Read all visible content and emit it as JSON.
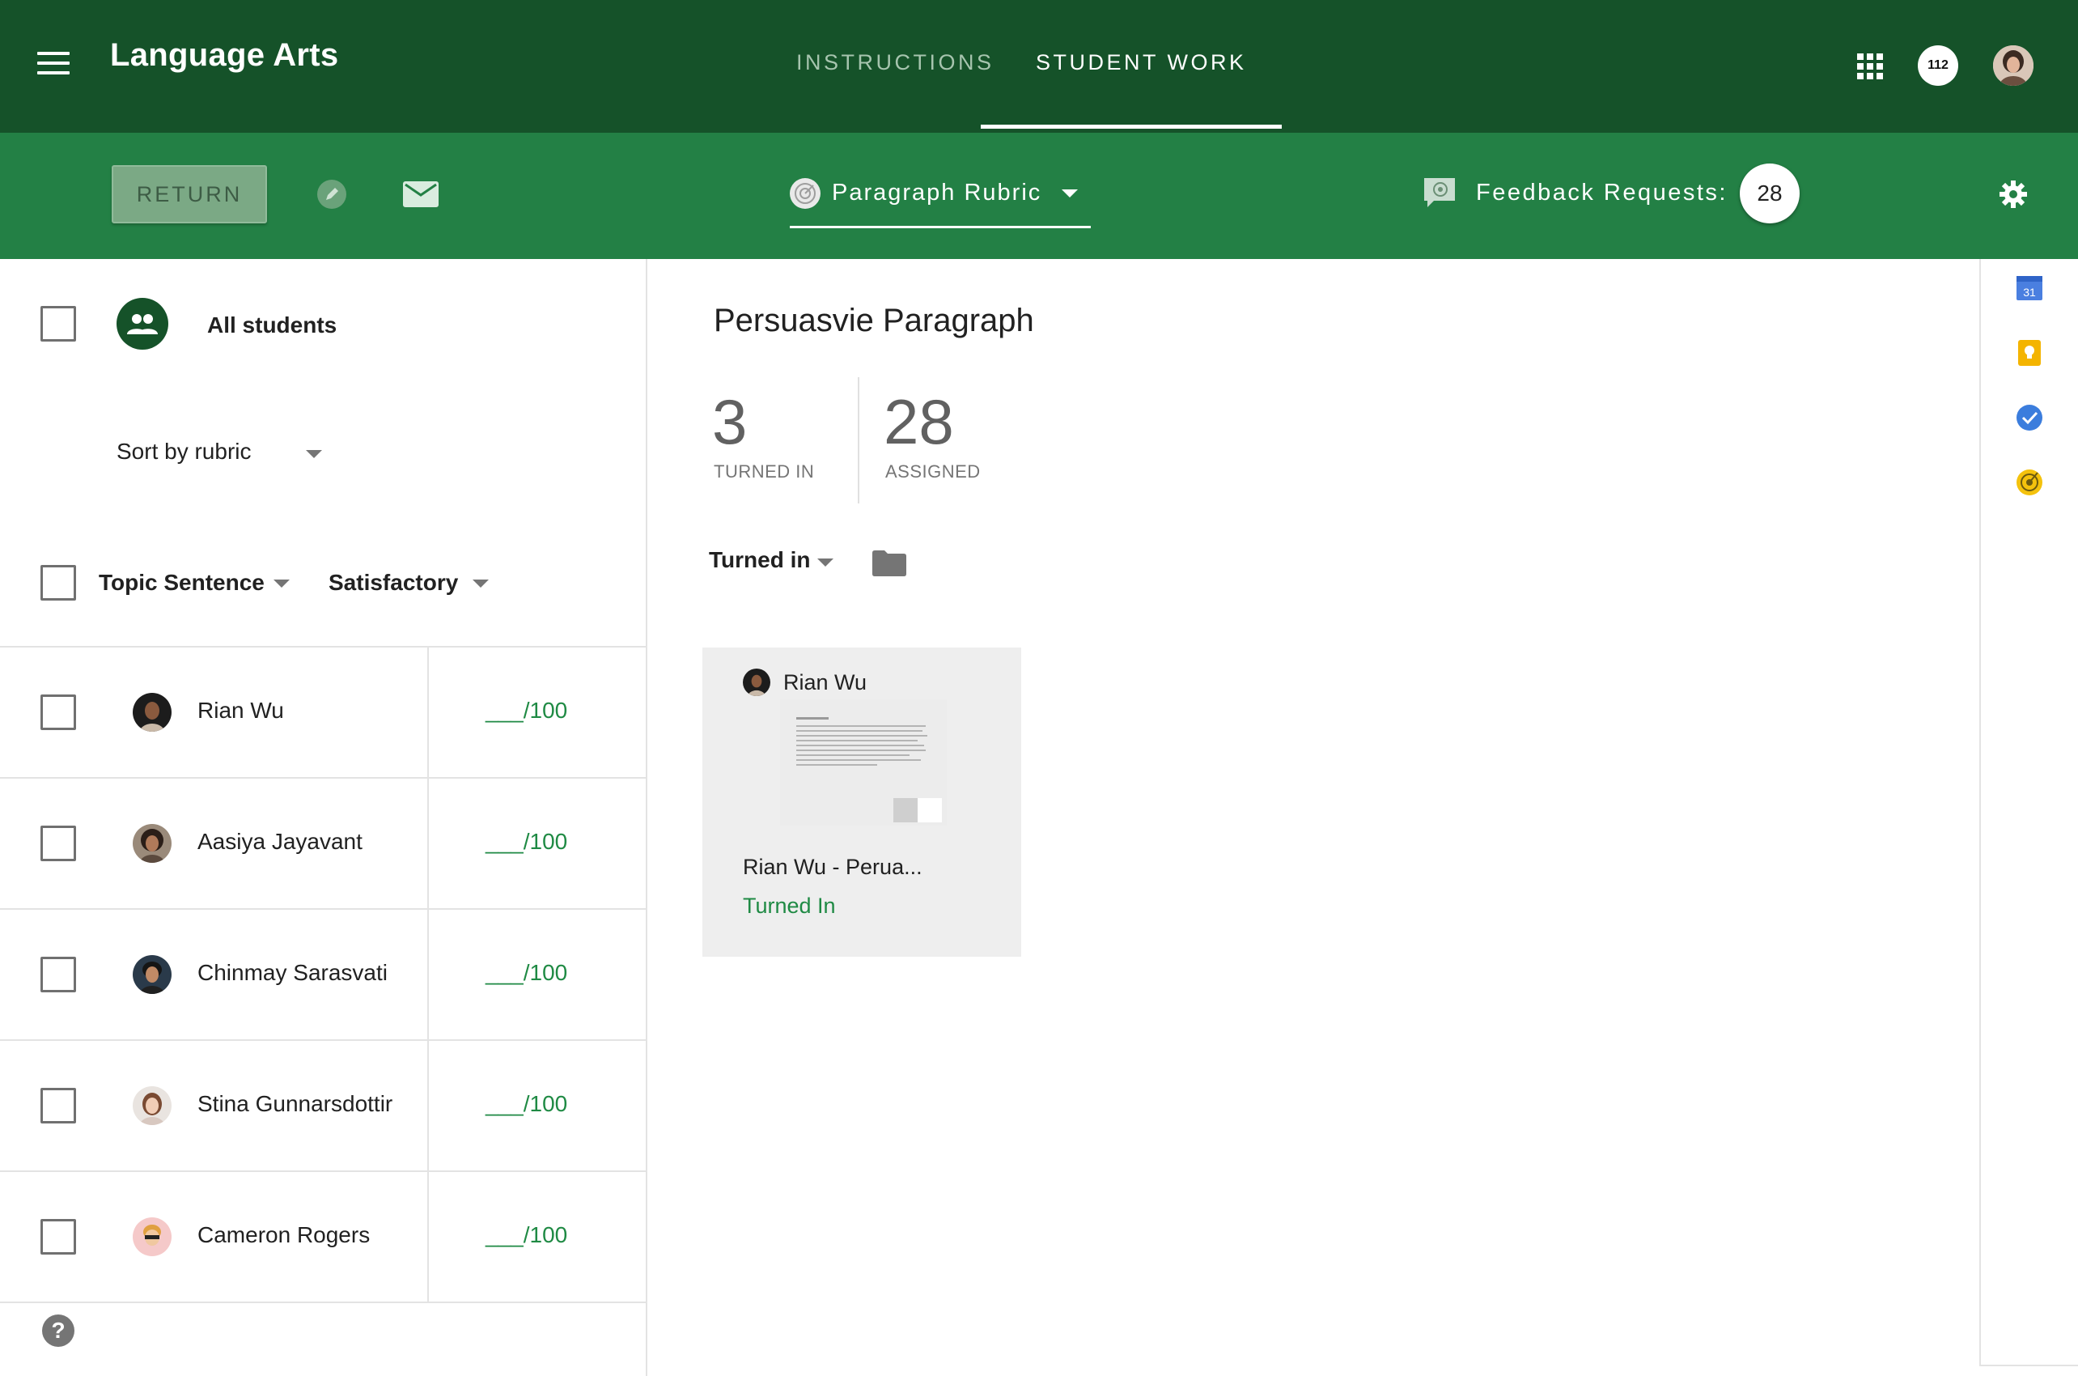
{
  "header": {
    "app_title": "Language Arts",
    "tabs": [
      {
        "label": "INSTRUCTIONS",
        "active": false
      },
      {
        "label": "STUDENT WORK",
        "active": true
      }
    ],
    "notification_count": "112",
    "icons": [
      "menu-icon",
      "apps-grid-icon",
      "account-avatar"
    ]
  },
  "toolbar": {
    "return_label": "RETURN",
    "rubric_label": "Paragraph Rubric",
    "feedback_label": "Feedback Requests:",
    "feedback_count": "28",
    "icons": [
      "grade-pencil-icon",
      "email-icon",
      "rubric-icon",
      "feedback-icon",
      "settings-gear-icon"
    ]
  },
  "left_panel": {
    "all_students_label": "All students",
    "sort_label": "Sort by rubric",
    "filter_criterion": "Topic Sentence",
    "filter_level": "Satisfactory",
    "students": [
      {
        "name": "Rian Wu",
        "grade": "___/100"
      },
      {
        "name": "Aasiya Jayavant",
        "grade": "___/100"
      },
      {
        "name": "Chinmay Sarasvati",
        "grade": "___/100"
      },
      {
        "name": "Stina Gunnarsdottir",
        "grade": "___/100"
      },
      {
        "name": "Cameron Rogers",
        "grade": "___/100"
      }
    ],
    "help_glyph": "?"
  },
  "main": {
    "assignment_title": "Persuasvie Paragraph",
    "turned_in_count": "3",
    "turned_in_label": "TURNED IN",
    "assigned_count": "28",
    "assigned_label": "ASSIGNED",
    "status_filter": "Turned in",
    "submission": {
      "student": "Rian Wu",
      "filename": "Rian Wu - Perua...",
      "status": "Turned In"
    }
  },
  "side_panel": {
    "calendar_day": "31",
    "icons": [
      "calendar-icon",
      "keep-bulb-icon",
      "tasks-check-icon",
      "rubric-badge-icon"
    ]
  },
  "colors": {
    "header_bg": "#155229",
    "toolbar_bg": "#238045",
    "accent_green": "#1f8a44"
  }
}
